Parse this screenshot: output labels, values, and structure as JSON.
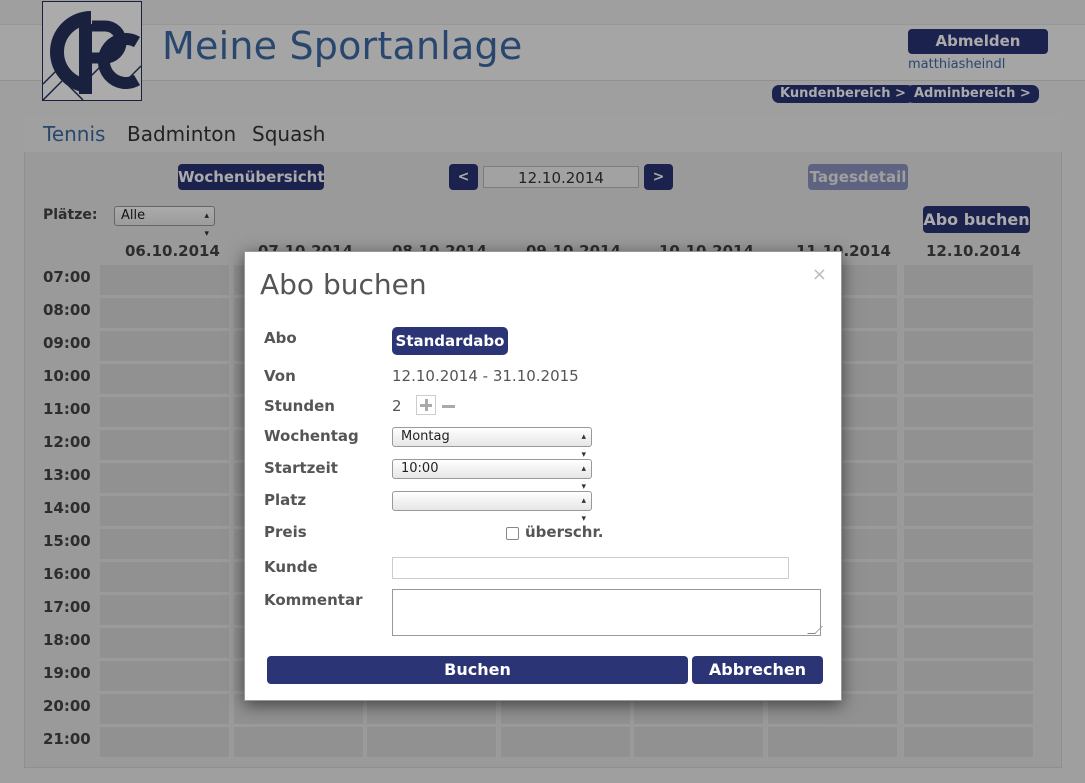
{
  "header": {
    "site_title": "Meine Sportanlage",
    "logout_label": "Abmelden",
    "username": "matthiasheindl",
    "customer_area_label": "Kundenbereich >",
    "admin_area_label": "Adminbereich >"
  },
  "sports": {
    "tabs": [
      {
        "label": "Tennis",
        "active": true
      },
      {
        "label": "Badminton",
        "active": false
      },
      {
        "label": "Squash",
        "active": false
      }
    ]
  },
  "toolbar": {
    "week_overview_label": "Wochenübersicht",
    "prev_label": "<",
    "date": "12.10.2014",
    "next_label": ">",
    "day_detail_label": "Tagesdetail",
    "courts_label": "Plätze:",
    "courts_value": "Alle",
    "subscription_label": "Abo buchen"
  },
  "calendar": {
    "days": [
      "06.10.2014",
      "07.10.2014",
      "08.10.2014",
      "09.10.2014",
      "10.10.2014",
      "11.10.2014",
      "12.10.2014"
    ],
    "times": [
      "07:00",
      "08:00",
      "09:00",
      "10:00",
      "11:00",
      "12:00",
      "13:00",
      "14:00",
      "15:00",
      "16:00",
      "17:00",
      "18:00",
      "19:00",
      "20:00",
      "21:00"
    ]
  },
  "modal": {
    "title": "Abo buchen",
    "close_symbol": "×",
    "abo_label": "Abo",
    "abo_type": "Standardabo",
    "von_label": "Von",
    "von_value": "12.10.2014 - 31.10.2015",
    "stunden_label": "Stunden",
    "stunden_value": "2",
    "wochentag_label": "Wochentag",
    "wochentag_value": "Montag",
    "startzeit_label": "Startzeit",
    "startzeit_value": "10:00",
    "platz_label": "Platz",
    "platz_value": "",
    "preis_label": "Preis",
    "override_label": "überschr.",
    "override_checked": false,
    "kunde_label": "Kunde",
    "kunde_value": "",
    "kommentar_label": "Kommentar",
    "kommentar_value": "",
    "book_label": "Buchen",
    "cancel_label": "Abbrechen"
  },
  "colors": {
    "navy": "#2b3475",
    "title_blue": "#3e6ba5",
    "disabled_button": "#8c94c2"
  }
}
